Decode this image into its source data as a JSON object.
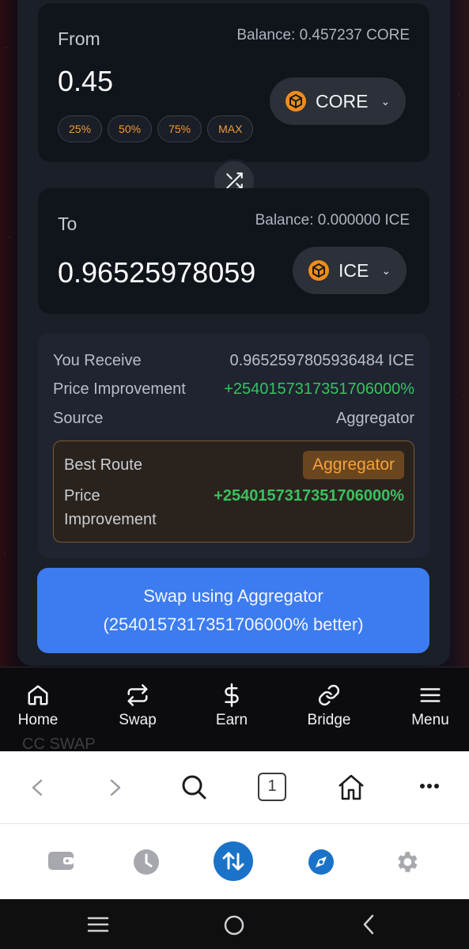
{
  "from": {
    "label": "From",
    "balance": "Balance: 0.457237 CORE",
    "amount": "0.45",
    "percent_buttons": [
      "25%",
      "50%",
      "75%",
      "MAX"
    ],
    "token": "CORE"
  },
  "to": {
    "label": "To",
    "balance": "Balance: 0.000000 ICE",
    "amount": "0.96525978059",
    "token": "ICE"
  },
  "details": {
    "receive_label": "You Receive",
    "receive_value": "0.9652597805936484 ICE",
    "improvement_label": "Price Improvement",
    "improvement_value": "+254015731735170600​0%",
    "source_label": "Source",
    "source_value": "Aggregator"
  },
  "route": {
    "best_route_label": "Best Route",
    "best_route_value": "Aggregator",
    "improvement_label_1": "Price",
    "improvement_label_2": "Improvement",
    "improvement_value": "+2540157317351706000%"
  },
  "swap_button": {
    "line1": "Swap using Aggregator",
    "line2": "(2540157317351706000% better)"
  },
  "bottom_nav": {
    "home": "Home",
    "swap": "Swap",
    "earn": "Earn",
    "bridge": "Bridge",
    "menu": "Menu"
  },
  "footer_ghost": "CC SWAP",
  "browser": {
    "tab_count": "1"
  },
  "colors": {
    "accent_blue": "#3c7cf0",
    "token_orange": "#f08c1a",
    "positive_green": "#37c25f",
    "dock_blue": "#1a73c9"
  },
  "icons": {
    "token": "hexagon-cube-icon",
    "switch": "shuffle-icon",
    "nav": [
      "home-icon",
      "swap-arrows-icon",
      "dollar-icon",
      "link-icon",
      "menu-icon"
    ],
    "browser": [
      "back-icon",
      "forward-icon",
      "search-icon",
      "tabs-icon",
      "home-icon",
      "more-icon"
    ],
    "dock": [
      "wallet-icon",
      "clock-icon",
      "swap-vertical-icon",
      "compass-icon",
      "gear-icon"
    ],
    "system": [
      "recents-icon",
      "home-circle-icon",
      "back-icon"
    ]
  }
}
